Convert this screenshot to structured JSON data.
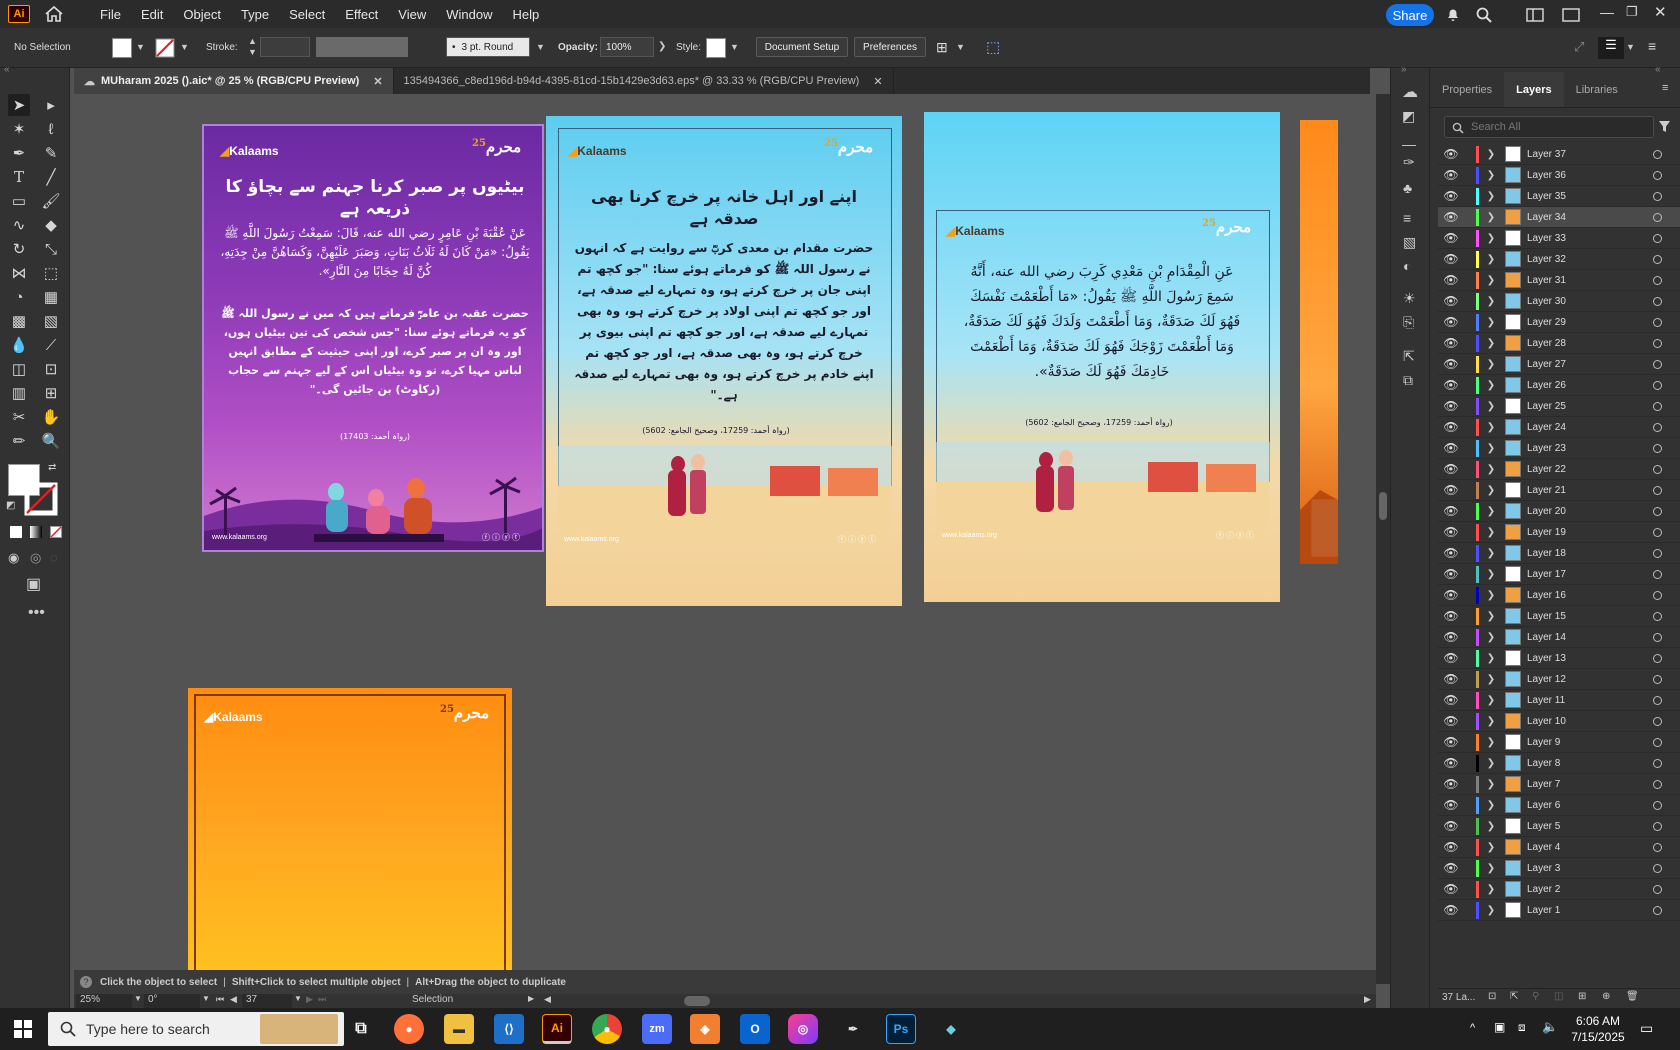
{
  "app": {
    "logo": "Ai",
    "menus": [
      "File",
      "Edit",
      "Object",
      "Type",
      "Select",
      "Effect",
      "View",
      "Window",
      "Help"
    ],
    "share_label": "Share"
  },
  "control_bar": {
    "selection": "No Selection",
    "stroke_label": "Stroke:",
    "brush": "3 pt. Round",
    "opacity_label": "Opacity:",
    "opacity_value": "100%",
    "style_label": "Style:",
    "document_setup": "Document Setup",
    "preferences": "Preferences"
  },
  "tabs": [
    {
      "label": "MUharam 2025 ().aic* @ 25 % (RGB/CPU Preview)",
      "active": true
    },
    {
      "label": "135494366_c8ed196d-b94d-4395-81cd-15b1429e3d63.eps* @ 33.33 % (RGB/CPU Preview)",
      "active": false
    }
  ],
  "status_bar": {
    "hint_1": "Click the object to select",
    "hint_2": "Shift+Click to select multiple object",
    "hint_3": "Alt+Drag the object to duplicate",
    "zoom": "25%",
    "rotation": "0°",
    "artboard_number": "37",
    "tool": "Selection"
  },
  "artboards": {
    "brand": "Kalaams",
    "url": "www.kalaams.org",
    "muharram_badge": "محرم",
    "muharram_number": "25",
    "purple": {
      "title": "بیٹیوں پر صبر کرنا جہنم سے بچاؤ کا ذریعہ ہے",
      "arabic": "عَنْ عُقْبَةَ بْنِ عَامِرٍ رضي الله عنه، قَالَ: سَمِعْتُ رَسُولَ اللَّهِ ﷺ يَقُولُ: «مَنْ كَانَ لَهُ ثَلَاثُ بَنَاتٍ، وَصَبَرَ عَلَيْهِنَّ، وَكَسَاهُنَّ مِنْ جِدَتِهِ، كُنَّ لَهُ حِجَابًا مِنَ النَّارِ».",
      "urdu": "حضرت عقبہ بن عامرؓ فرماتے ہیں کہ میں نے رسول اللہ ﷺ کو یہ فرماتے ہوئے سنا: \"جس شخص کی تین بیٹیاں ہوں، اور وہ ان پر صبر کرے، اور اپنی حیثیت کے مطابق انہیں لباس مہیا کرے، تو وہ بیٹیاں اس کے لیے جہنم سے حجاب (رکاوٹ) بن جائیں گی۔\"",
      "ref": "(رواہ أحمد: 17403)"
    },
    "blue1": {
      "title": "اپنے اور اہل خانہ پر خرچ کرنا بھی صدقہ ہے",
      "urdu": "حضرت مقدام بن معدی کربؓ سے روایت ہے کہ انہوں نے رسول اللہ ﷺ کو فرماتے ہوئے سنا: \"جو کچھ تم اپنی جان پر خرچ کرتے ہو، وہ تمہارے لیے صدقہ ہے، اور جو کچھ تم اپنی اولاد پر خرچ کرتے ہو، وہ بھی تمہارے لیے صدقہ ہے، اور جو کچھ تم اپنی بیوی پر خرچ کرتے ہو، وہ بھی صدقہ ہے، اور جو کچھ تم اپنے خادم پر خرچ کرتے ہو، وہ بھی تمہارے لیے صدقہ ہے۔\"",
      "ref": "(رواہ أحمد: 17259، وصحیح الجامع: 5602)"
    },
    "blue2": {
      "arabic": "عَنِ الْمِقْدَامِ بْنِ مَعْدِي كَرِبَ رضي الله عنه، أَنَّهُ سَمِعَ رَسُولَ اللَّهِ ﷺ يَقُولُ: «مَا أَطْعَمْتَ نَفْسَكَ فَهُوَ لَكَ صَدَقَةٌ، وَمَا أَطْعَمْتَ وَلَدَكَ فَهُوَ لَكَ صَدَقَةٌ، وَمَا أَطْعَمْتَ زَوْجَكَ فَهُوَ لَكَ صَدَقَةٌ، وَمَا أَطْعَمْتَ خَادِمَكَ فَهُوَ لَكَ صَدَقَةٌ».",
      "ref": "(رواہ أحمد: 17259، وصحیح الجامع: 5602)"
    }
  },
  "panel": {
    "tabs": [
      "Properties",
      "Layers",
      "Libraries"
    ],
    "active_tab": "Layers",
    "search_placeholder": "Search All",
    "footer_count": "37 La...",
    "selected_layer": "Layer 34",
    "layers": [
      {
        "name": "Layer 37",
        "color": "#ff4f4f"
      },
      {
        "name": "Layer 36",
        "color": "#4f4fff"
      },
      {
        "name": "Layer 35",
        "color": "#4fffff"
      },
      {
        "name": "Layer 34",
        "color": "#4fff4f"
      },
      {
        "name": "Layer 33",
        "color": "#ff4fff"
      },
      {
        "name": "Layer 32",
        "color": "#ffff4f"
      },
      {
        "name": "Layer 31",
        "color": "#ff7f4f"
      },
      {
        "name": "Layer 30",
        "color": "#7fff7f"
      },
      {
        "name": "Layer 29",
        "color": "#4f7fff"
      },
      {
        "name": "Layer 28",
        "color": "#4f4fff"
      },
      {
        "name": "Layer 27",
        "color": "#ffdf4f"
      },
      {
        "name": "Layer 26",
        "color": "#4fff7f"
      },
      {
        "name": "Layer 25",
        "color": "#7f4fff"
      },
      {
        "name": "Layer 24",
        "color": "#ff4f4f"
      },
      {
        "name": "Layer 23",
        "color": "#4fbfff"
      },
      {
        "name": "Layer 22",
        "color": "#ff4f7f"
      },
      {
        "name": "Layer 21",
        "color": "#bf7f4f"
      },
      {
        "name": "Layer 20",
        "color": "#4fff4f"
      },
      {
        "name": "Layer 19",
        "color": "#ff4f4f"
      },
      {
        "name": "Layer 18",
        "color": "#4f4fff"
      },
      {
        "name": "Layer 17",
        "color": "#4fbfbf"
      },
      {
        "name": "Layer 16",
        "color": "#0000bf"
      },
      {
        "name": "Layer 15",
        "color": "#ff9f2f"
      },
      {
        "name": "Layer 14",
        "color": "#bf4fff"
      },
      {
        "name": "Layer 13",
        "color": "#4fff9f"
      },
      {
        "name": "Layer 12",
        "color": "#bf9f4f"
      },
      {
        "name": "Layer 11",
        "color": "#ff4fbf"
      },
      {
        "name": "Layer 10",
        "color": "#9f4fff"
      },
      {
        "name": "Layer 9",
        "color": "#ff7f2f"
      },
      {
        "name": "Layer 8",
        "color": "#000000"
      },
      {
        "name": "Layer 7",
        "color": "#7f7f7f"
      },
      {
        "name": "Layer 6",
        "color": "#4f9fff"
      },
      {
        "name": "Layer 5",
        "color": "#4fbf4f"
      },
      {
        "name": "Layer 4",
        "color": "#ff4f4f"
      },
      {
        "name": "Layer 3",
        "color": "#4fff4f"
      },
      {
        "name": "Layer 2",
        "color": "#ff4f4f"
      },
      {
        "name": "Layer 1",
        "color": "#4f4fff"
      }
    ]
  },
  "taskbar": {
    "search_placeholder": "Type here to search",
    "time": "6:06 AM",
    "date": "7/15/2025"
  }
}
